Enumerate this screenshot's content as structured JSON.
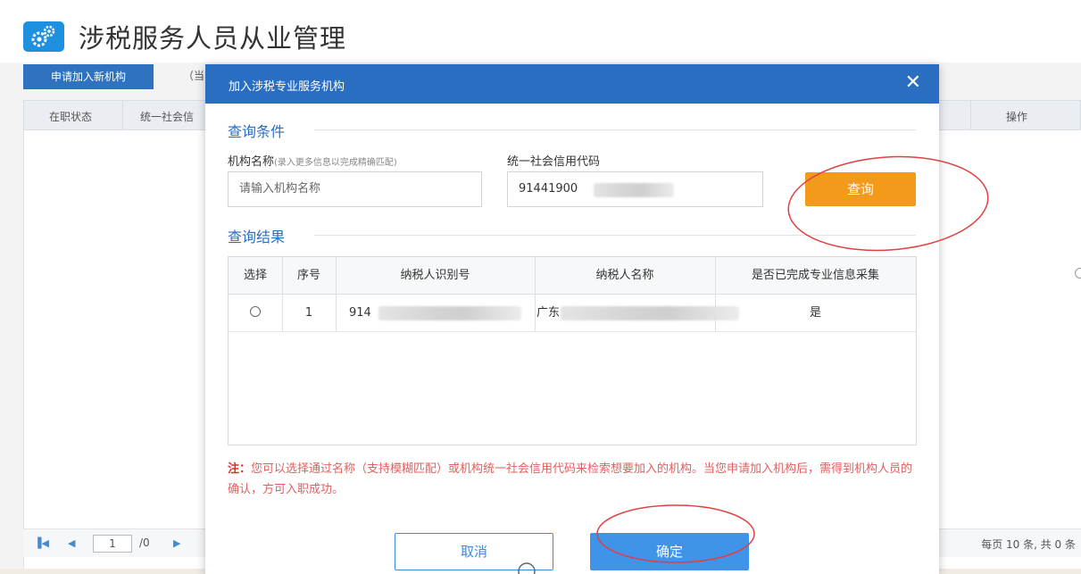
{
  "page": {
    "title": "涉税服务人员从业管理",
    "icon": "gears-icon"
  },
  "background": {
    "apply_button": "申请加入新机构",
    "toolbar_note": "（当",
    "columns": [
      "在职状态",
      "统一社会信",
      "操作"
    ],
    "pager": {
      "page_value": "1",
      "total": "/0",
      "info": "每页 10 条, 共 0 条"
    }
  },
  "modal": {
    "title": "加入涉税专业服务机构",
    "close_icon": "close-icon",
    "query_section": "查询条件",
    "name_label": "机构名称",
    "name_hint": "(录入更多信息以完成精确匹配)",
    "name_placeholder": "请输入机构名称",
    "code_label": "统一社会信用代码",
    "code_value": "91441900",
    "query_button": "查询",
    "result_section": "查询结果",
    "table": {
      "headers": [
        "选择",
        "序号",
        "纳税人识别号",
        "纳税人名称",
        "是否已完成专业信息采集"
      ],
      "rows": [
        {
          "index": "1",
          "tax_id": "914",
          "name": "广东",
          "collected": "是"
        }
      ]
    },
    "note_label": "注：",
    "note_text": "您可以选择通过名称（支持模糊匹配）或机构统一社会信用代码来检索想要加入的机构。当您申请加入机构后，需得到机构人员的确认，方可入职成功。",
    "cancel_button": "取消",
    "ok_button": "确定"
  },
  "colors": {
    "header_blue": "#2a6ec1",
    "query_orange": "#f39a1a",
    "ok_blue": "#3f93e8",
    "note_red": "#e06060",
    "annotation_red": "#e04040"
  }
}
